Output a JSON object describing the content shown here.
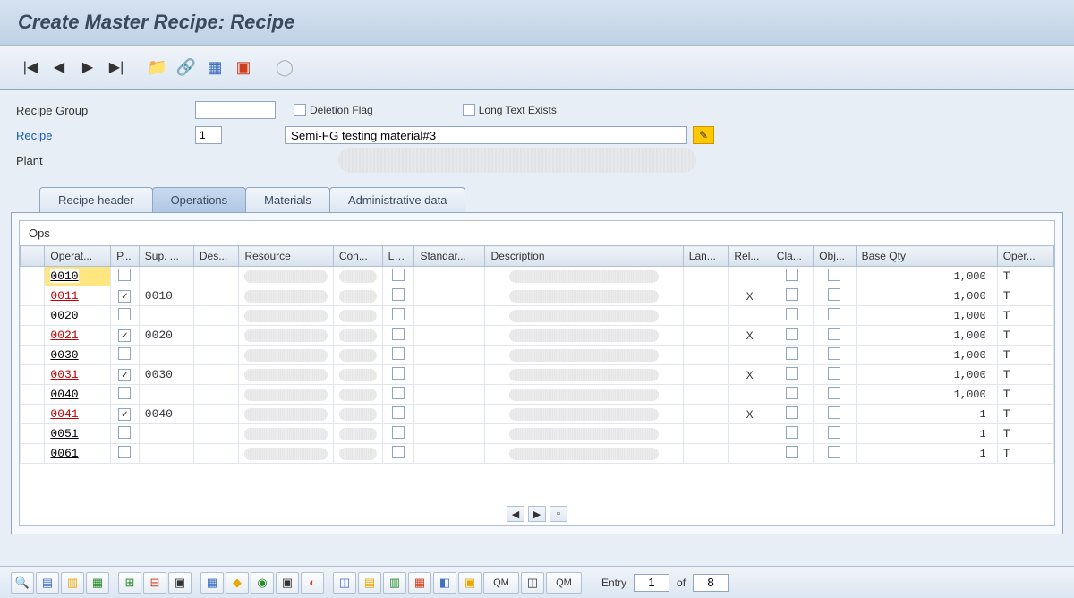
{
  "title": "Create Master Recipe: Recipe",
  "header": {
    "recipe_group_label": "Recipe Group",
    "recipe_group_value": "",
    "deletion_flag_label": "Deletion Flag",
    "long_text_label": "Long Text Exists",
    "recipe_label": "Recipe",
    "recipe_value": "1",
    "recipe_desc": "Semi-FG testing material#3",
    "plant_label": "Plant"
  },
  "tabs": {
    "header": "Recipe header",
    "operations": "Operations",
    "materials": "Materials",
    "admin": "Administrative data"
  },
  "grid": {
    "title": "Ops",
    "columns": {
      "operat": "Operat...",
      "p": "P...",
      "sup": "Sup. ...",
      "des": "Des...",
      "resource": "Resource",
      "con": "Con...",
      "lo": "Lo...",
      "standar": "Standar...",
      "description": "Description",
      "lan": "Lan...",
      "rel": "Rel...",
      "cla": "Cla...",
      "obj": "Obj...",
      "baseqty": "Base Qty",
      "oper": "Oper..."
    },
    "rows": [
      {
        "op": "0010",
        "op_color": "black",
        "hl": true,
        "p": false,
        "sup": "",
        "rel": "",
        "bq": "1,000",
        "unit": "T"
      },
      {
        "op": "0011",
        "op_color": "red",
        "hl": false,
        "p": true,
        "sup": "0010",
        "rel": "X",
        "bq": "1,000",
        "unit": "T"
      },
      {
        "op": "0020",
        "op_color": "black",
        "hl": false,
        "p": false,
        "sup": "",
        "rel": "",
        "bq": "1,000",
        "unit": "T"
      },
      {
        "op": "0021",
        "op_color": "red",
        "hl": false,
        "p": true,
        "sup": "0020",
        "rel": "X",
        "bq": "1,000",
        "unit": "T"
      },
      {
        "op": "0030",
        "op_color": "black",
        "hl": false,
        "p": false,
        "sup": "",
        "rel": "",
        "bq": "1,000",
        "unit": "T"
      },
      {
        "op": "0031",
        "op_color": "red",
        "hl": false,
        "p": true,
        "sup": "0030",
        "rel": "X",
        "bq": "1,000",
        "unit": "T"
      },
      {
        "op": "0040",
        "op_color": "black",
        "hl": false,
        "p": false,
        "sup": "",
        "rel": "",
        "bq": "1,000",
        "unit": "T"
      },
      {
        "op": "0041",
        "op_color": "red",
        "hl": false,
        "p": true,
        "sup": "0040",
        "rel": "X",
        "bq": "1",
        "unit": "T"
      },
      {
        "op": "0051",
        "op_color": "black",
        "hl": false,
        "p": false,
        "sup": "",
        "rel": "",
        "bq": "1",
        "unit": "T"
      },
      {
        "op": "0061",
        "op_color": "black",
        "hl": false,
        "p": false,
        "sup": "",
        "rel": "",
        "bq": "1",
        "unit": "T"
      }
    ]
  },
  "footer": {
    "qm": "QM",
    "entry_label": "Entry",
    "entry_value": "1",
    "of_label": "of",
    "total": "8"
  }
}
